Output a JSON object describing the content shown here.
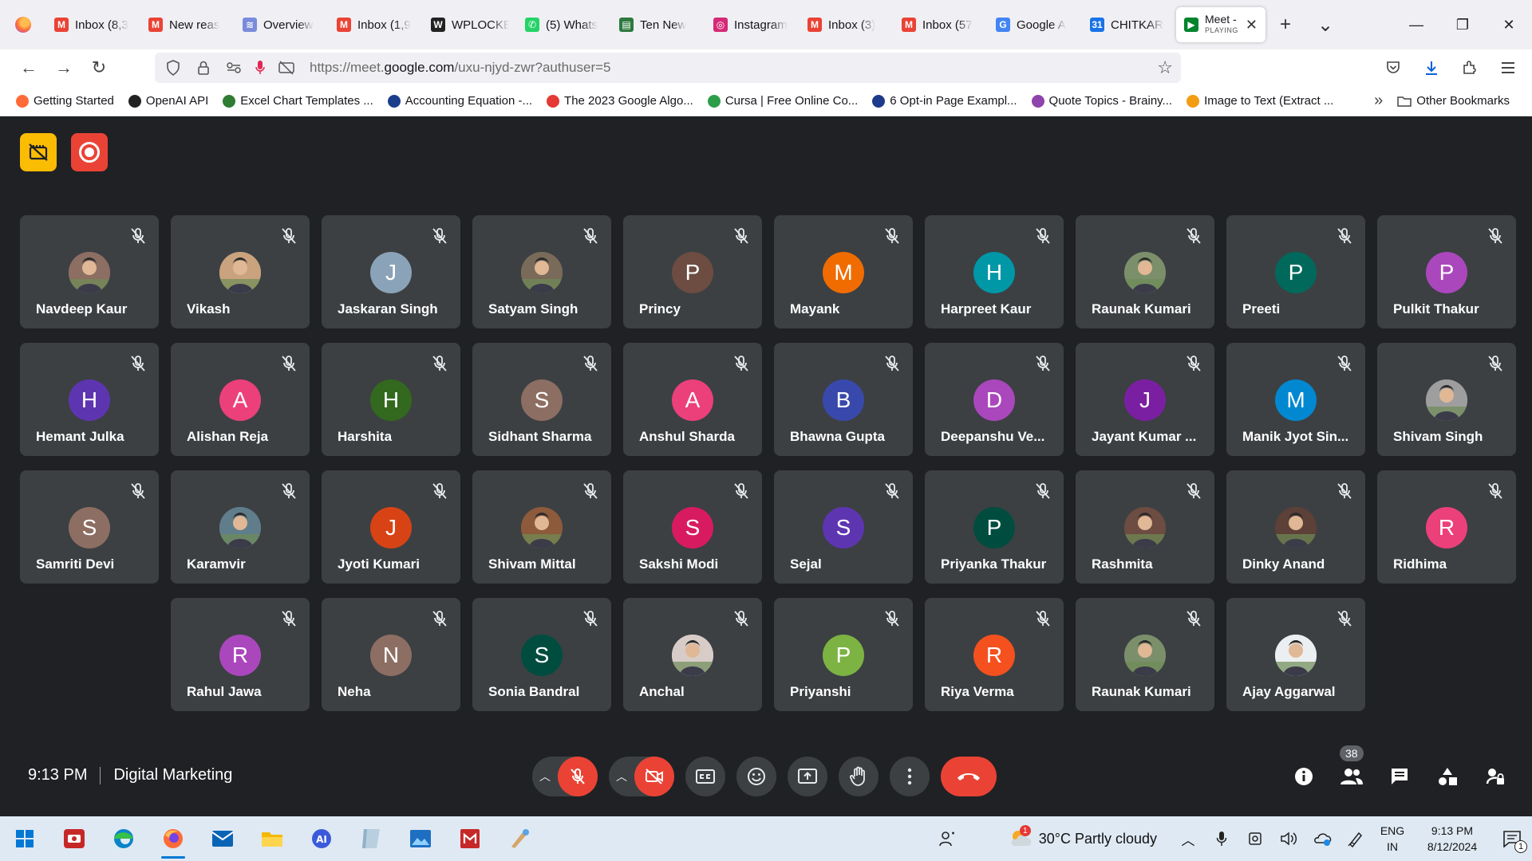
{
  "browser": {
    "tabs": [
      {
        "label": "Inbox (8,3",
        "icon": "gmail-icon"
      },
      {
        "label": "New reas",
        "icon": "gmail-icon"
      },
      {
        "label": "Overview",
        "icon": "overview-icon"
      },
      {
        "label": "Inbox (1,9",
        "icon": "gmail-icon"
      },
      {
        "label": "WPLOCKE",
        "icon": "wplocker-icon"
      },
      {
        "label": "(5) Whats",
        "icon": "whatsapp-icon"
      },
      {
        "label": "Ten New",
        "icon": "article-icon"
      },
      {
        "label": "Instagram",
        "icon": "instagram-icon"
      },
      {
        "label": "Inbox (3)",
        "icon": "gmail-icon"
      },
      {
        "label": "Inbox (57",
        "icon": "gmail-icon"
      },
      {
        "label": "Google A",
        "icon": "google-icon"
      },
      {
        "label": "CHITKAR",
        "icon": "calendar-icon"
      }
    ],
    "active_tab": {
      "label": "Meet -",
      "sub": "PLAYING",
      "icon": "meet-icon"
    },
    "url_prefix": "https://meet.",
    "url_domain": "google.com",
    "url_suffix": "/uxu-njyd-zwr?authuser=5",
    "bookmarks": [
      {
        "label": "Getting Started",
        "color": "#ff6b38"
      },
      {
        "label": "OpenAI API",
        "color": "#222222"
      },
      {
        "label": "Excel Chart Templates ...",
        "color": "#2e7d32"
      },
      {
        "label": "Accounting Equation -...",
        "color": "#1a3e8c"
      },
      {
        "label": "The 2023 Google Algo...",
        "color": "#e53935"
      },
      {
        "label": "Cursa | Free Online Co...",
        "color": "#2e9d4a"
      },
      {
        "label": "6 Opt-in Page Exampl...",
        "color": "#1e3a8a"
      },
      {
        "label": "Quote Topics - Brainy...",
        "color": "#8e44ad"
      },
      {
        "label": "Image to Text (Extract ...",
        "color": "#f39c12"
      }
    ],
    "other_bookmarks": "Other Bookmarks"
  },
  "meet": {
    "time": "9:13 PM",
    "meeting_name": "Digital Marketing",
    "participant_count": "38",
    "participants": [
      {
        "name": "Navdeep Kaur",
        "initial": "",
        "color": "#8d6e63",
        "photo": true
      },
      {
        "name": "Vikash",
        "initial": "",
        "color": "#c9a27e",
        "photo": true
      },
      {
        "name": "Jaskaran Singh",
        "initial": "J",
        "color": "#8ba3b8",
        "photo": false
      },
      {
        "name": "Satyam Singh",
        "initial": "",
        "color": "#7a6a5a",
        "photo": true
      },
      {
        "name": "Princy",
        "initial": "P",
        "color": "#6d4c41",
        "photo": false
      },
      {
        "name": "Mayank",
        "initial": "M",
        "color": "#f06c00",
        "photo": false
      },
      {
        "name": "Harpreet Kaur",
        "initial": "H",
        "color": "#0097a7",
        "photo": false
      },
      {
        "name": "Raunak Kumari",
        "initial": "",
        "color": "#7c8f6b",
        "photo": true
      },
      {
        "name": "Preeti",
        "initial": "P",
        "color": "#00695c",
        "photo": false
      },
      {
        "name": "Pulkit Thakur",
        "initial": "P",
        "color": "#ab47bc",
        "photo": false
      },
      {
        "name": "Hemant Julka",
        "initial": "H",
        "color": "#5e35b1",
        "photo": false
      },
      {
        "name": "Alishan Reja",
        "initial": "A",
        "color": "#ec407a",
        "photo": false
      },
      {
        "name": "Harshita",
        "initial": "H",
        "color": "#33691e",
        "photo": false
      },
      {
        "name": "Sidhant Sharma",
        "initial": "S",
        "color": "#8d6e63",
        "photo": false
      },
      {
        "name": "Anshul Sharda",
        "initial": "A",
        "color": "#ec407a",
        "photo": false
      },
      {
        "name": "Bhawna Gupta",
        "initial": "B",
        "color": "#3949ab",
        "photo": false
      },
      {
        "name": "Deepanshu Ve...",
        "initial": "D",
        "color": "#ab47bc",
        "photo": false
      },
      {
        "name": "Jayant Kumar ...",
        "initial": "J",
        "color": "#7b1fa2",
        "photo": false
      },
      {
        "name": "Manik Jyot Sin...",
        "initial": "M",
        "color": "#0288d1",
        "photo": false
      },
      {
        "name": "Shivam Singh",
        "initial": "",
        "color": "#9e9e9e",
        "photo": true
      },
      {
        "name": "Samriti Devi",
        "initial": "S",
        "color": "#8d6e63",
        "photo": false
      },
      {
        "name": "Karamvir",
        "initial": "",
        "color": "#607d8b",
        "photo": true
      },
      {
        "name": "Jyoti Kumari",
        "initial": "J",
        "color": "#d84315",
        "photo": false
      },
      {
        "name": "Shivam Mittal",
        "initial": "",
        "color": "#8d5a3b",
        "photo": true
      },
      {
        "name": "Sakshi Modi",
        "initial": "S",
        "color": "#d81b60",
        "photo": false
      },
      {
        "name": "Sejal",
        "initial": "S",
        "color": "#5e35b1",
        "photo": false
      },
      {
        "name": "Priyanka Thakur",
        "initial": "P",
        "color": "#004d40",
        "photo": false
      },
      {
        "name": "Rashmita",
        "initial": "",
        "color": "#6d4c41",
        "photo": true
      },
      {
        "name": "Dinky Anand",
        "initial": "",
        "color": "#5d4037",
        "photo": true
      },
      {
        "name": "Ridhima",
        "initial": "R",
        "color": "#ec407a",
        "photo": false
      },
      {
        "name": "Rahul Jawa",
        "initial": "R",
        "color": "#ab47bc",
        "photo": false
      },
      {
        "name": "Neha",
        "initial": "N",
        "color": "#8d6e63",
        "photo": false
      },
      {
        "name": "Sonia Bandral",
        "initial": "S",
        "color": "#004d40",
        "photo": false
      },
      {
        "name": "Anchal",
        "initial": "",
        "color": "#d7ccc8",
        "photo": true
      },
      {
        "name": "Priyanshi",
        "initial": "P",
        "color": "#7cb342",
        "photo": false
      },
      {
        "name": "Riya Verma",
        "initial": "R",
        "color": "#f4511e",
        "photo": false
      },
      {
        "name": "Raunak Kumari",
        "initial": "",
        "color": "#7c8f6b",
        "photo": true
      },
      {
        "name": "Ajay Aggarwal",
        "initial": "",
        "color": "#eceff1",
        "photo": true
      }
    ]
  },
  "taskbar": {
    "weather": "30°C  Partly cloudy",
    "weather_alert": "1",
    "lang_top": "ENG",
    "lang_bottom": "IN",
    "time": "9:13 PM",
    "date": "8/12/2024",
    "notifications": "1"
  }
}
